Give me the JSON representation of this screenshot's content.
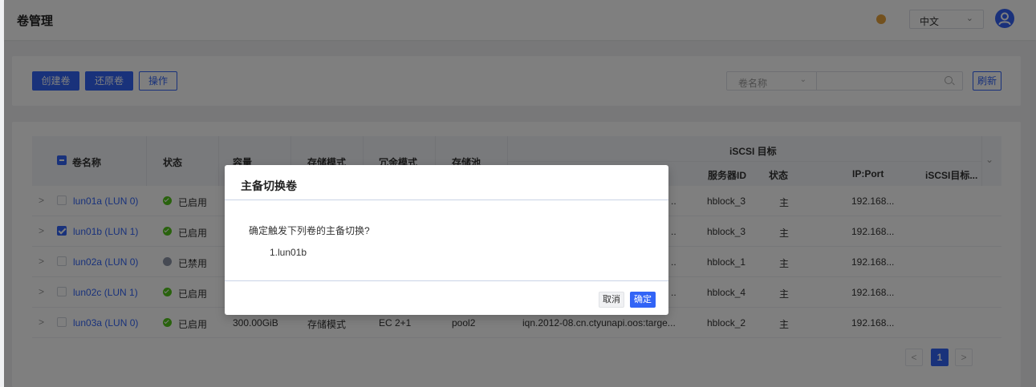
{
  "header": {
    "title": "卷管理",
    "language": "中文"
  },
  "toolbar": {
    "create_label": "创建卷",
    "restore_label": "还原卷",
    "operation_label": "操作",
    "search_field": "卷名称",
    "search_value": "",
    "refresh_label": "刷新"
  },
  "table": {
    "headers": {
      "name": "卷名称",
      "status": "状态",
      "capacity": "容量",
      "storage_mode": "存储模式",
      "redundancy": "冗余模式",
      "pool": "存储池",
      "iscsi_group": "iSCSI 目标",
      "server_id": "服务器ID",
      "iscsi_status": "状态",
      "ip_port": "IP:Port",
      "iscsi_target": "iSCSI目标..."
    },
    "rows": [
      {
        "name": "lun01a (LUN 0)",
        "checked": false,
        "status": "已启用",
        "status_state": "on",
        "server": "hblock_3",
        "role": "主",
        "ip": "192.168..."
      },
      {
        "name": "lun01b (LUN 1)",
        "checked": true,
        "status": "已启用",
        "status_state": "on",
        "server": "hblock_3",
        "role": "主",
        "ip": "192.168..."
      },
      {
        "name": "lun02a (LUN 0)",
        "checked": false,
        "status": "已禁用",
        "status_state": "off",
        "server": "hblock_1",
        "role": "主",
        "ip": "192.168..."
      },
      {
        "name": "lun02c (LUN 1)",
        "checked": false,
        "status": "已启用",
        "status_state": "on",
        "server": "hblock_4",
        "role": "主",
        "ip": "192.168..."
      },
      {
        "name": "lun03a (LUN 0)",
        "checked": false,
        "status": "已启用",
        "status_state": "on",
        "capacity": "300.00GiB",
        "storage_mode": "存储模式",
        "redundancy": "EC 2+1",
        "pool": "pool2",
        "target": "iqn.2012-08.cn.ctyunapi.oos:targe...",
        "server": "hblock_2",
        "role": "主",
        "ip": "192.168..."
      }
    ],
    "truncated_target": ".."
  },
  "pagination": {
    "current": "1",
    "prev": "<",
    "next": ">"
  },
  "modal": {
    "title": "主备切换卷",
    "message": "确定触发下列卷的主备切换?",
    "item": "1.lun01b",
    "cancel_label": "取消",
    "ok_label": "确定"
  },
  "colors": {
    "primary": "#3264f6",
    "enabled": "#52c41a",
    "disabled": "#8c95a6",
    "warning": "#e6a23c"
  }
}
